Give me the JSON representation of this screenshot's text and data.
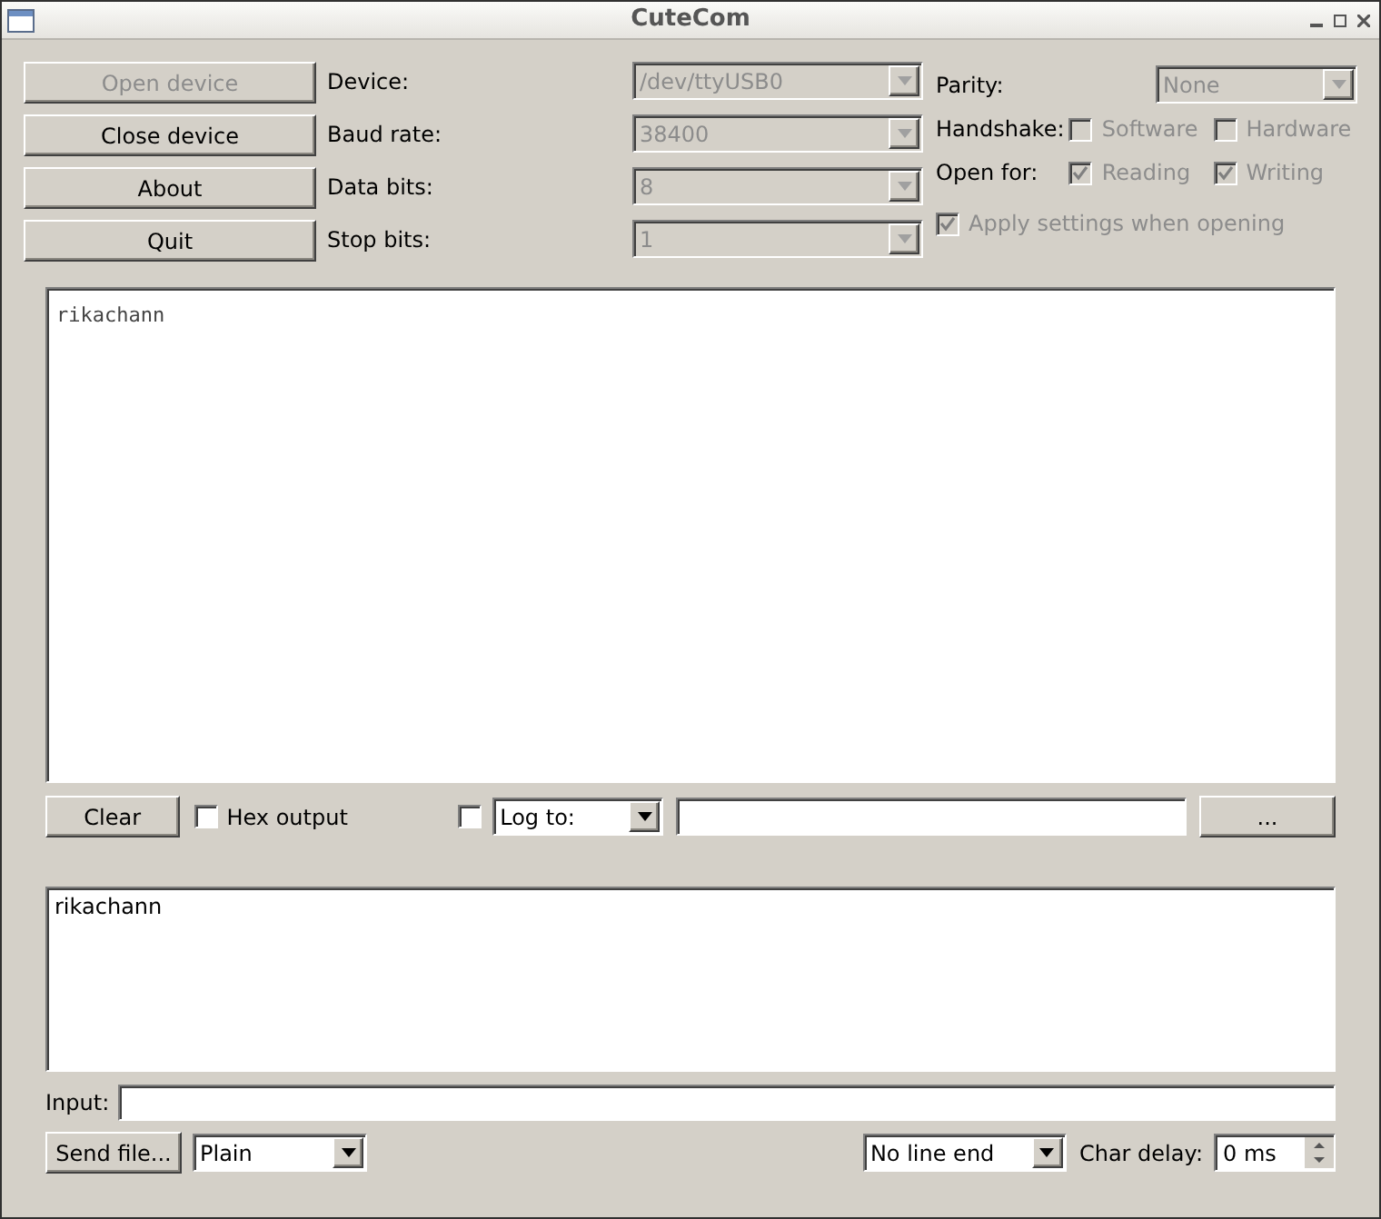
{
  "window": {
    "title": "CuteCom"
  },
  "device_buttons": [
    {
      "label": "Open device",
      "disabled": true
    },
    {
      "label": "Close device",
      "disabled": false
    },
    {
      "label": "About",
      "disabled": false
    },
    {
      "label": "Quit",
      "disabled": false
    }
  ],
  "settings": [
    {
      "label": "Device:",
      "value": "/dev/ttyUSB0",
      "disabled": true
    },
    {
      "label": "Baud rate:",
      "value": "38400",
      "disabled": true
    },
    {
      "label": "Data bits:",
      "value": "8",
      "disabled": true
    },
    {
      "label": "Stop bits:",
      "value": "1",
      "disabled": true
    }
  ],
  "parity": {
    "label": "Parity:",
    "value": "None",
    "disabled": true
  },
  "handshake": {
    "label": "Handshake:",
    "options": [
      {
        "label": "Software",
        "checked": false,
        "disabled": true
      },
      {
        "label": "Hardware",
        "checked": false,
        "disabled": true
      }
    ]
  },
  "open_for": {
    "label": "Open for:",
    "options": [
      {
        "label": "Reading",
        "checked": true,
        "disabled": true
      },
      {
        "label": "Writing",
        "checked": true,
        "disabled": true
      }
    ]
  },
  "apply_settings": {
    "label": "Apply settings when opening",
    "checked": true,
    "disabled": true
  },
  "output": {
    "text": "rikachann"
  },
  "output_controls": {
    "clear_button": "Clear",
    "hex_output": {
      "label": "Hex output",
      "checked": false
    },
    "log_enabled": {
      "checked": false
    },
    "log_mode": "Log to:",
    "browse_button": "..."
  },
  "input_history": {
    "text": "rikachann"
  },
  "input": {
    "label": "Input:"
  },
  "bottom": {
    "send_file_button": "Send file...",
    "format": "Plain",
    "line_end": "No line end",
    "char_delay_label": "Char delay:",
    "char_delay": "0 ms"
  }
}
